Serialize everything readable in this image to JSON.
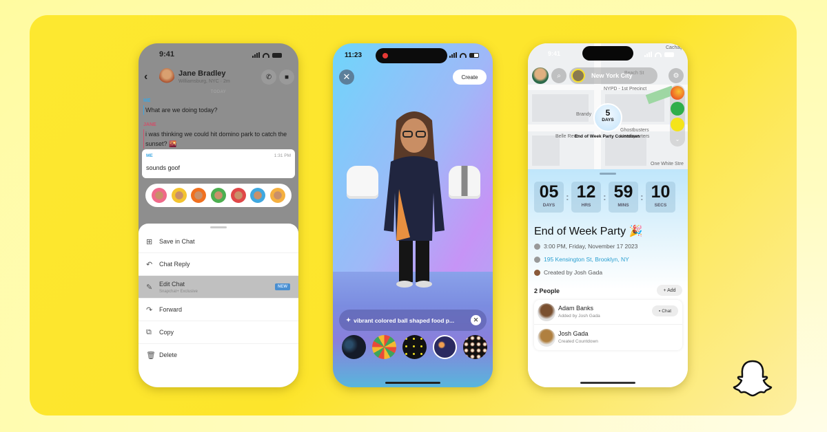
{
  "colors": {
    "background": "#fffcb8",
    "card": "#fde930",
    "accent_blue": "#3aa6e2",
    "jane_red": "#e5475a",
    "new_badge": "#4a8fd0"
  },
  "chat_screen": {
    "status_time": "9:41",
    "contact_name": "Jane Bradley",
    "contact_sub": "Williamsburg, NYC · 2m",
    "day_label": "TODAY",
    "messages": [
      {
        "sender": "ME",
        "text": "What are we doing today?"
      },
      {
        "sender": "JANE",
        "text": "i was thinking we could hit domino park to catch the sunset? 🌇"
      }
    ],
    "selected_message": {
      "sender": "ME",
      "time": "1:31 PM",
      "text": "sounds goof"
    },
    "reactions": [
      "heart-bitmoji",
      "cry-laugh-bitmoji",
      "fire-bitmoji",
      "thumbs-up-bitmoji",
      "exclaim-bitmoji",
      "cry-bitmoji",
      "party-bitmoji"
    ],
    "menu": [
      {
        "icon": "save-icon",
        "glyph": "⊞",
        "label": "Save in Chat"
      },
      {
        "icon": "reply-icon",
        "glyph": "↶",
        "label": "Chat Reply"
      },
      {
        "icon": "pencil-icon",
        "glyph": "✎",
        "label": "Edit Chat",
        "sub": "Snapchat+ Exclusive",
        "badge": "NEW"
      },
      {
        "icon": "forward-icon",
        "glyph": "↷",
        "label": "Forward"
      },
      {
        "icon": "copy-icon",
        "glyph": "⧉",
        "label": "Copy"
      },
      {
        "icon": "trash-icon",
        "glyph": "🗑",
        "label": "Delete"
      }
    ]
  },
  "bitmoji_screen": {
    "status_time": "11:23",
    "close_glyph": "✕",
    "create_label": "Create",
    "prompt_text": "vibrant colored ball shaped food p...",
    "prompt_icon": "✦",
    "clear_glyph": "✕",
    "patterns": [
      "pattern-dark-floral",
      "pattern-colorful-stickers",
      "pattern-yellow-dollar",
      "pattern-planets-selected",
      "pattern-spheres"
    ]
  },
  "map_screen": {
    "status_time": "9:41",
    "location": "New York City",
    "map_labels": [
      "Beach St",
      "NYPD - 1st Precinct",
      "Brandy",
      "Belle Reve",
      "Ghostbusters Headquarters",
      "One White Stre",
      "Cachaç"
    ],
    "days_bubble": {
      "value": "5",
      "unit": "DAYS"
    },
    "event_label": "End of Week Party Countdown",
    "countdown": [
      {
        "value": "05",
        "unit": "DAYS"
      },
      {
        "value": "12",
        "unit": "HRS"
      },
      {
        "value": "59",
        "unit": "MINS"
      },
      {
        "value": "10",
        "unit": "SECS"
      }
    ],
    "event_title": "End of Week Party 🎉",
    "event_time": "3:00 PM, Friday, November 17 2023",
    "event_address": "195 Kensington St, Brooklyn, NY",
    "event_creator": "Created by Josh Gada",
    "people_count": "2 People",
    "add_label": "+ Add",
    "people": [
      {
        "name": "Adam Banks",
        "sub": "Added by Josh Gada",
        "action": "Chat"
      },
      {
        "name": "Josh Gada",
        "sub": "Created Countdown"
      }
    ]
  },
  "brand": {
    "logo": "snapchat-ghost"
  }
}
